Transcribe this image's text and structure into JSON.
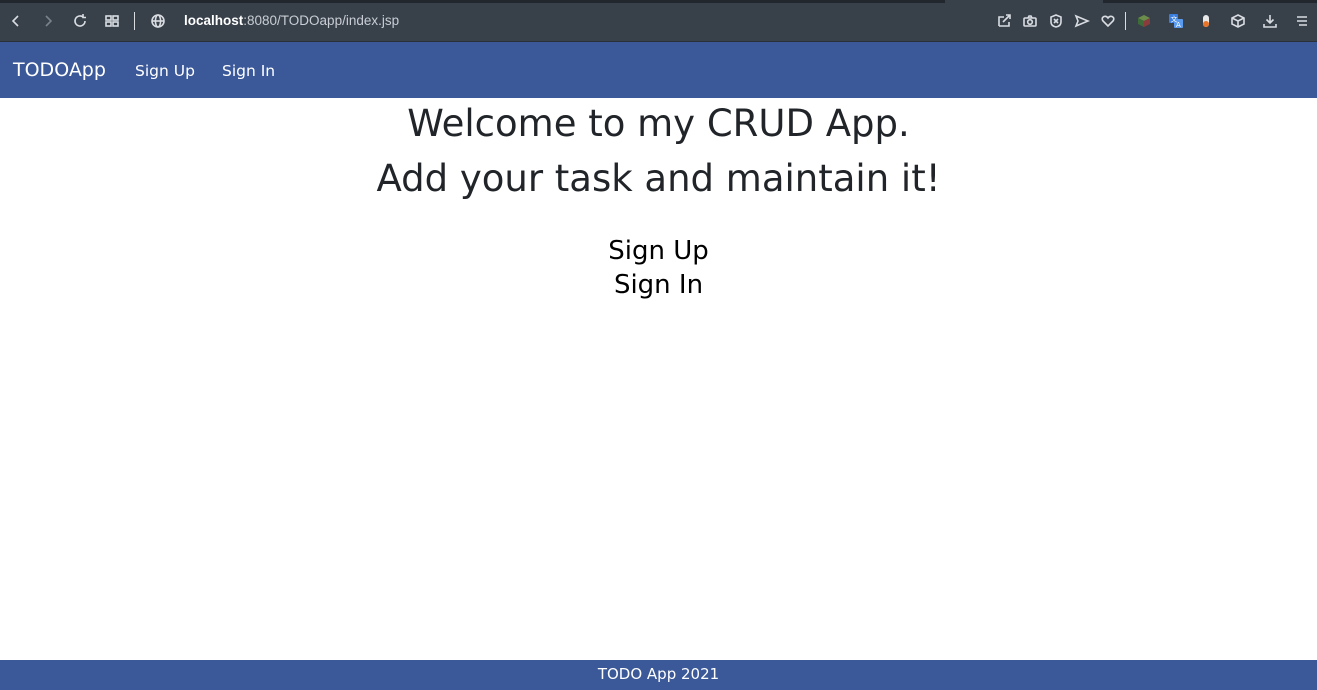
{
  "browser": {
    "url_host": "localhost",
    "url_rest": ":8080/TODOapp/index.jsp"
  },
  "navbar": {
    "brand": "TODOApp",
    "links": [
      "Sign Up",
      "Sign In"
    ]
  },
  "main": {
    "heading_line1": "Welcome to my CRUD App.",
    "heading_line2": "Add your task and maintain it!",
    "signup_link": "Sign Up",
    "signin_link": "Sign In"
  },
  "footer": {
    "text": "TODO App 2021"
  },
  "colors": {
    "navbar_bg": "#3b5998",
    "chrome_bg": "#38404a",
    "heading": "#212529"
  }
}
